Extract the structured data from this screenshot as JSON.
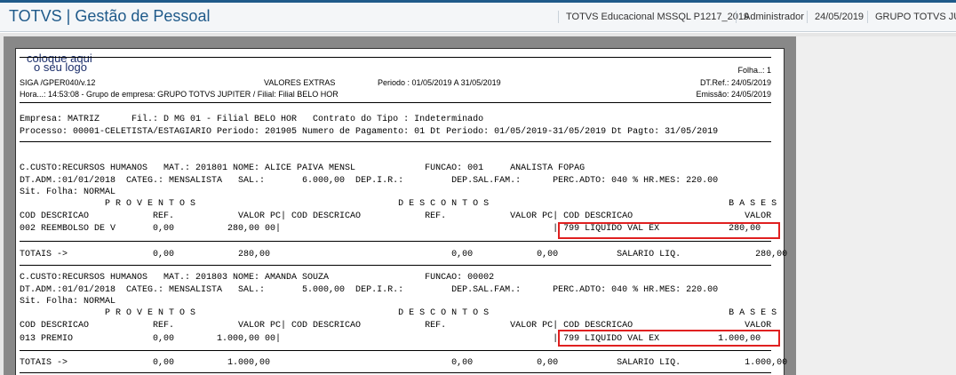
{
  "app": {
    "title": "TOTVS | Gestão de Pessoal",
    "accent": "#1f5a8a"
  },
  "status": {
    "environment": "TOTVS Educacional MSSQL P1217_2019",
    "user": "Administrador",
    "date": "24/05/2019",
    "group": "GRUPO TOTVS JUPITER"
  },
  "report": {
    "logo_line1": "coloque aqui",
    "logo_line2": "o seu logo",
    "folha": "Folha..:  1",
    "program": "SIGA /GPER040/v.12",
    "title": "VALORES EXTRAS",
    "periodo": "Periodo : 01/05/2019 A 31/05/2019",
    "dtref": "DT.Ref.: 24/05/2019",
    "hora": "Hora...: 14:53:08 - Grupo de empresa: GRUPO TOTVS JUPITER / Filial: Filial BELO HOR",
    "emissao": "Emissão: 24/05/2019",
    "empresa_line": "Empresa: MATRIZ      Fil.: D MG 01 - Filial BELO HOR   Contrato do Tipo : Indeterminado",
    "processo_line": "Processo: 00001-CELETISTA/ESTAGIARIO Periodo: 201905 Numero de Pagamento: 01 Dt Periodo: 01/05/2019-31/05/2019 Dt Pagto: 31/05/2019",
    "employees": [
      {
        "line1": "C.CUSTO:RECURSOS HUMANOS   MAT.: 201801 NOME: ALICE PAIVA MENSL             FUNCAO: 001     ANALISTA FOPAG",
        "line2": "DT.ADM.:01/01/2018  CATEG.: MENSALISTA   SAL.:       6.000,00  DEP.I.R.:         DEP.SAL.FAM.:      PERC.ADTO: 040 % HR.MES: 220.00",
        "line3": "Sit. Folha: NORMAL",
        "section_headers": "                P R O V E N T O S                                      D E S C O N T O S                                             B A S E S",
        "column_headers": "COD DESCRICAO            REF.            VALOR PC| COD DESCRICAO            REF.            VALOR PC| COD DESCRICAO                     VALOR",
        "row": "002 REEMBOLSO DE V       0,00          280,00 00|                                                   | 799 LIQUIDO VAL EX             280,00",
        "totals": "TOTAIS ->                0,00            280,00                                  0,00            0,00           SALARIO LIQ.              280,00"
      },
      {
        "line1": "C.CUSTO:RECURSOS HUMANOS   MAT.: 201803 NOME: AMANDA SOUZA                  FUNCAO: 00002",
        "line2": "DT.ADM.:01/01/2018  CATEG.: MENSALISTA   SAL.:       5.000,00  DEP.I.R.:         DEP.SAL.FAM.:      PERC.ADTO: 040 % HR.MES: 220.00",
        "line3": "Sit. Folha: NORMAL",
        "section_headers": "                P R O V E N T O S                                      D E S C O N T O S                                             B A S E S",
        "column_headers": "COD DESCRICAO            REF.            VALOR PC| COD DESCRICAO            REF.            VALOR PC| COD DESCRICAO                     VALOR",
        "row": "013 PREMIO               0,00        1.000,00 00|                                                   | 799 LIQUIDO VAL EX           1.000,00",
        "totals": "TOTAIS ->                0,00          1.000,00                                  0,00            0,00           SALARIO LIQ.            1.000,00"
      }
    ]
  },
  "highlight_color": "#e02020"
}
